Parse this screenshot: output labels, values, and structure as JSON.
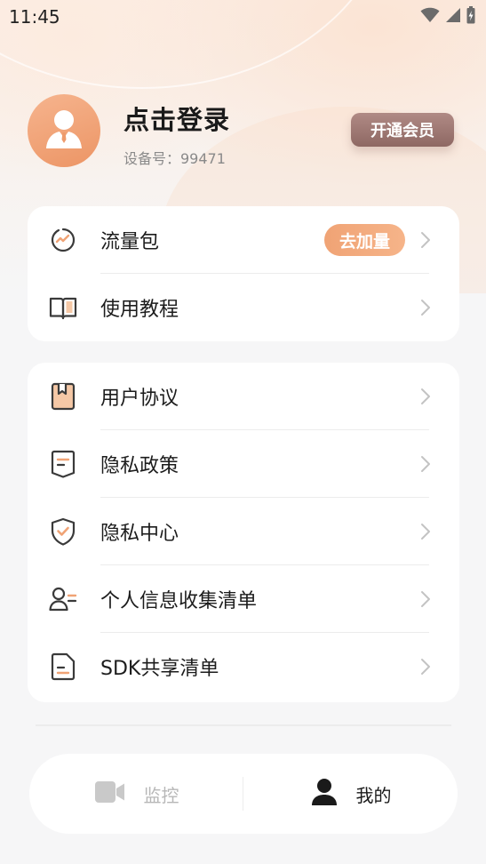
{
  "status_bar": {
    "time": "11:45",
    "icons": [
      "wifi-icon",
      "signal-icon",
      "battery-charging-icon"
    ]
  },
  "profile": {
    "title": "点击登录",
    "device_id": "设备号：99471",
    "vip_button": "开通会员",
    "avatar_icon": "user-avatar-icon"
  },
  "card1": {
    "items": [
      {
        "label": "流量包",
        "icon": "traffic-icon",
        "badge": "去加量"
      },
      {
        "label": "使用教程",
        "icon": "book-icon"
      }
    ]
  },
  "card2": {
    "items": [
      {
        "label": "用户协议",
        "icon": "bookmark-doc-icon"
      },
      {
        "label": "隐私政策",
        "icon": "policy-doc-icon"
      },
      {
        "label": "隐私中心",
        "icon": "shield-check-icon"
      },
      {
        "label": "个人信息收集清单",
        "icon": "user-list-icon"
      },
      {
        "label": "SDK共享清单",
        "icon": "file-list-icon"
      }
    ]
  },
  "tab_bar": {
    "tabs": [
      {
        "label": "监控",
        "icon": "video-camera-icon",
        "active": false
      },
      {
        "label": "我的",
        "icon": "person-icon",
        "active": true
      }
    ]
  },
  "colors": {
    "accent": "#f0a375",
    "vip": "#9e7772",
    "text_primary": "#1c1c1c",
    "text_secondary": "#8a8a8a",
    "tab_inactive": "#b7b7b7"
  }
}
